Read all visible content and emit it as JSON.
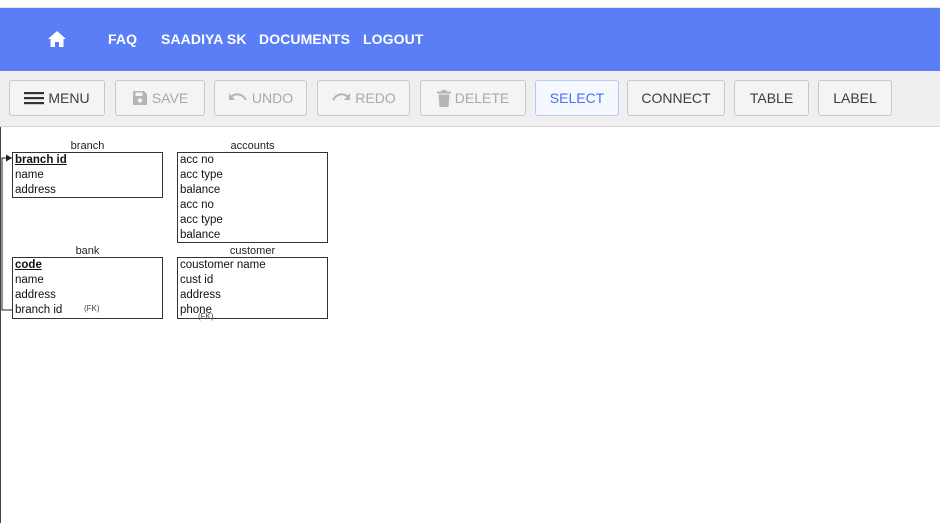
{
  "nav": {
    "links": [
      "FAQ",
      "SAADIYA SK",
      "DOCUMENTS",
      "LOGOUT"
    ]
  },
  "toolbar": {
    "menu": "MENU",
    "save": "SAVE",
    "undo": "UNDO",
    "redo": "REDO",
    "delete": "DELETE",
    "select": "SELECT",
    "connect": "CONNECT",
    "table": "TABLE",
    "label": "LABEL"
  },
  "entities": {
    "branch": {
      "title": "branch",
      "rows": [
        "branch id",
        "name",
        "address"
      ]
    },
    "accounts": {
      "title": "accounts",
      "rows": [
        "acc no",
        "acc type",
        "balance",
        "acc no",
        "acc type",
        "balance"
      ]
    },
    "bank": {
      "title": "bank",
      "rows": [
        "code",
        "name",
        "address",
        "branch id"
      ],
      "fk": "(FK)"
    },
    "customer": {
      "title": "customer",
      "rows": [
        "coustomer name",
        "cust id",
        "address",
        "phone"
      ],
      "fk": "(FK)"
    }
  },
  "colors": {
    "nav": "#5a7ef6",
    "accent": "#4a6ff0"
  }
}
